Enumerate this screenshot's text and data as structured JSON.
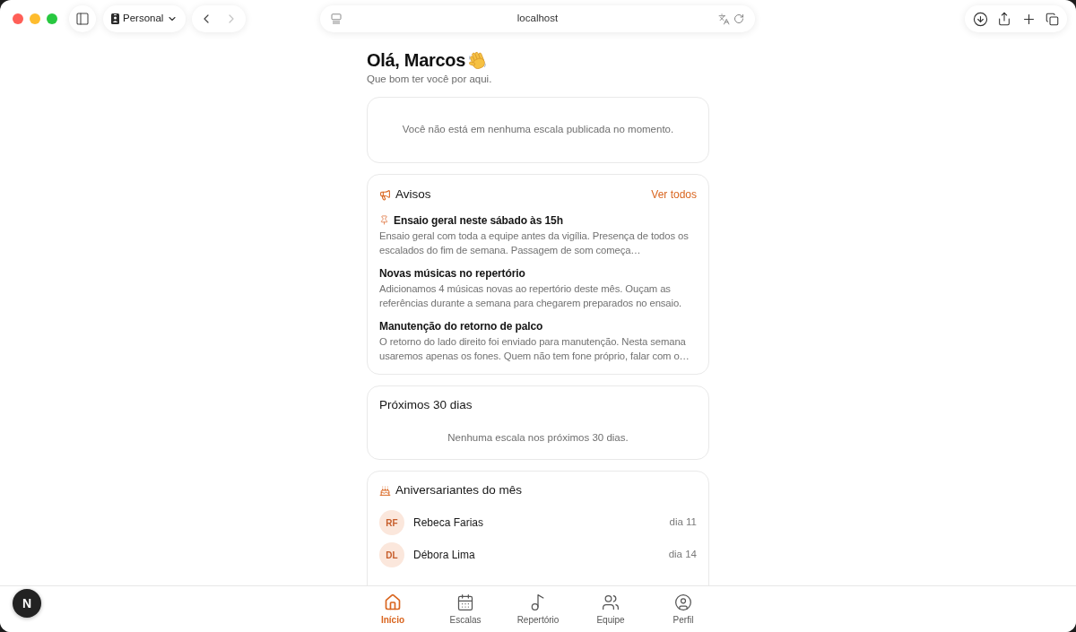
{
  "browser": {
    "profile": "Personal",
    "navigation": [
      {
        "kind": "back",
        "disabled": false
      },
      {
        "kind": "forward",
        "disabled": true
      }
    ],
    "address": "localhost"
  },
  "greeting": {
    "title": "Olá, Marcos",
    "subtitle": "Que bom ter você por aqui."
  },
  "my_schedule": {
    "message": "Você não está em nenhuma escala publicada no momento."
  },
  "notices": {
    "title": "Avisos",
    "link": "Ver todos",
    "items": [
      {
        "pinned": true,
        "title": "Ensaio geral neste sábado às 15h",
        "body": "Ensaio geral com toda a equipe antes da vigília. Presença de todos os escalados do fim de semana. Passagem de som começa…"
      },
      {
        "pinned": false,
        "title": "Novas músicas no repertório",
        "body": "Adicionamos 4 músicas novas ao repertório deste mês. Ouçam as referências durante a semana para chegarem preparados no ensaio."
      },
      {
        "pinned": false,
        "title": "Manutenção do retorno de palco",
        "body": "O retorno do lado direito foi enviado para manutenção. Nesta semana usaremos apenas os fones. Quem não tem fone próprio, falar com o…"
      }
    ]
  },
  "upcoming": {
    "title": "Próximos 30 dias",
    "message": "Nenhuma escala nos próximos 30 dias."
  },
  "birthdays": {
    "title": "Aniversariantes do mês",
    "items": [
      {
        "initials": "RF",
        "name": "Rebeca Farias",
        "day": "dia 11"
      },
      {
        "initials": "DL",
        "name": "Débora Lima",
        "day": "dia 14"
      }
    ]
  },
  "bottom_nav": [
    {
      "label": "Início",
      "selected": true
    },
    {
      "label": "Escalas",
      "selected": false
    },
    {
      "label": "Repertório",
      "selected": false
    },
    {
      "label": "Equipe",
      "selected": false
    },
    {
      "label": "Perfil",
      "selected": false
    }
  ],
  "dev_badge": {
    "label": "N"
  }
}
